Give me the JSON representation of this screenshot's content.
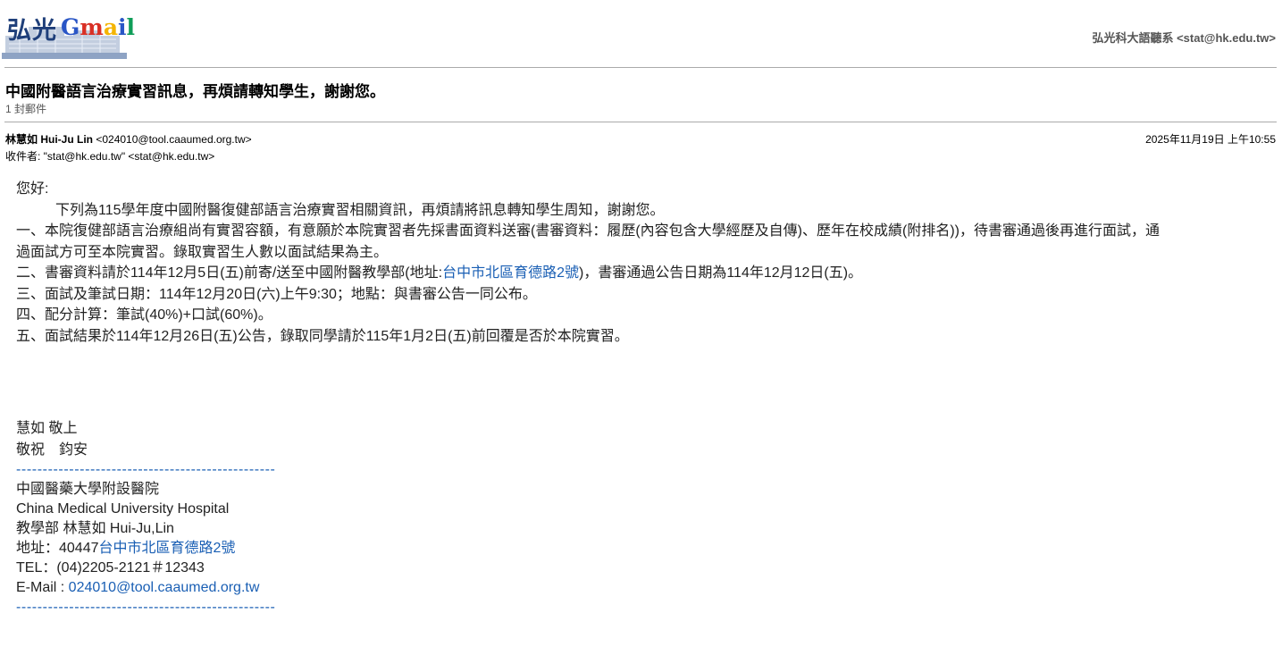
{
  "header": {
    "logo_cn": "弘光",
    "logo_gmail": "Gmail",
    "account": "弘光科大語聽系 <stat@hk.edu.tw>"
  },
  "thread": {
    "subject": "中國附醫語言治療實習訊息，再煩請轉知學生，謝謝您。",
    "count": "1 封郵件"
  },
  "message": {
    "sender_name": "林慧如 Hui-Ju Lin",
    "sender_email": "<024010@tool.caaumed.org.tw>",
    "date": "2025年11月19日 上午10:55",
    "to": "收件者: \"stat@hk.edu.tw\" <stat@hk.edu.tw>",
    "greeting": "您好:",
    "intro": "下列為115學年度中國附醫復健部語言治療實習相關資訊，再煩請將訊息轉知學生周知，謝謝您。",
    "item1_line1": "一、本院復健部語言治療組尚有實習容額，有意願於本院實習者先採書面資料送審(書審資料：履歷(內容包含大學經歷及自傳)、歷年在校成績(附排名))，待書審通過後再進行面試，通",
    "item1_line2": "過面試方可至本院實習。錄取實習生人數以面試結果為主。",
    "item2_pre": "二、書審資料請於114年12月5日(五)前寄/送至中國附醫教學部(地址:",
    "item2_link": "台中市北區育德路2號",
    "item2_post": ")，書審通過公告日期為114年12月12日(五)。",
    "item3": "三、面試及筆試日期：114年12月20日(六)上午9:30；地點：與書審公告一同公布。",
    "item4": "四、配分計算：筆試(40%)+口試(60%)。",
    "item5": "五、面試結果於114年12月26日(五)公告，錄取同學請於115年1月2日(五)前回覆是否於本院實習。",
    "closing1": "慧如 敬上",
    "closing2": "敬祝　鈞安",
    "divider": "-------------------------------------------------",
    "sig_org_cn": "中國醫藥大學附設醫院",
    "sig_org_en": "China Medical University Hospital",
    "sig_dept": "教學部 林慧如 Hui-Ju,Lin",
    "sig_addr_label": "地址：40447",
    "sig_addr_link": "台中市北區育德路2號",
    "sig_tel": "TEL：(04)2205-2121＃12343",
    "sig_email_label": "E-Mail : ",
    "sig_email_link": "024010@tool.caaumed.org.tw"
  },
  "colors": {
    "link": "#1a5fb4",
    "logo_blue": "#1f3f7a",
    "gmail_g": "#2a56c6",
    "gmail_m": "#d93025",
    "gmail_a": "#f4b400",
    "gmail_i": "#2a56c6",
    "gmail_l": "#0f9d58"
  }
}
